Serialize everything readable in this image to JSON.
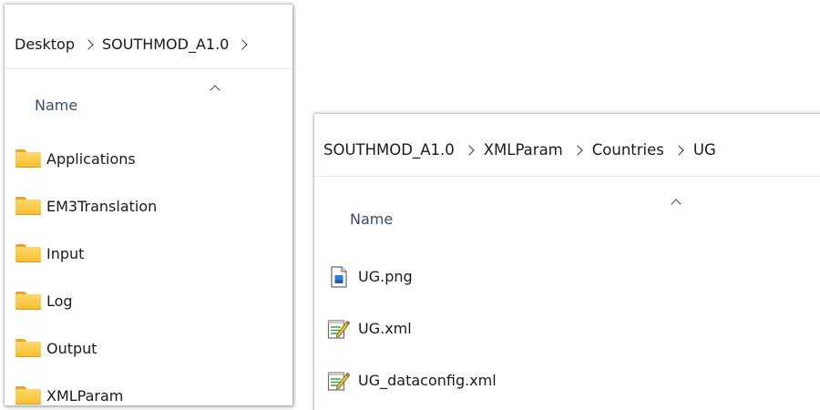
{
  "left_window": {
    "breadcrumb": [
      "Desktop",
      "SOUTHMOD_A1.0"
    ],
    "column_header": "Name",
    "items": [
      {
        "label": "Applications",
        "icon": "folder-icon"
      },
      {
        "label": "EM3Translation",
        "icon": "folder-icon"
      },
      {
        "label": "Input",
        "icon": "folder-icon"
      },
      {
        "label": "Log",
        "icon": "folder-icon"
      },
      {
        "label": "Output",
        "icon": "folder-icon"
      },
      {
        "label": "XMLParam",
        "icon": "folder-icon"
      }
    ]
  },
  "right_window": {
    "breadcrumb": [
      "SOUTHMOD_A1.0",
      "XMLParam",
      "Countries",
      "UG"
    ],
    "column_header": "Name",
    "items": [
      {
        "label": "UG.png",
        "icon": "image-file-icon"
      },
      {
        "label": "UG.xml",
        "icon": "xml-file-icon"
      },
      {
        "label": "UG_dataconfig.xml",
        "icon": "xml-file-icon"
      }
    ]
  },
  "colors": {
    "folder": "#f5bd2f",
    "header_text": "#3c4b66",
    "text": "#1a1a1a"
  }
}
